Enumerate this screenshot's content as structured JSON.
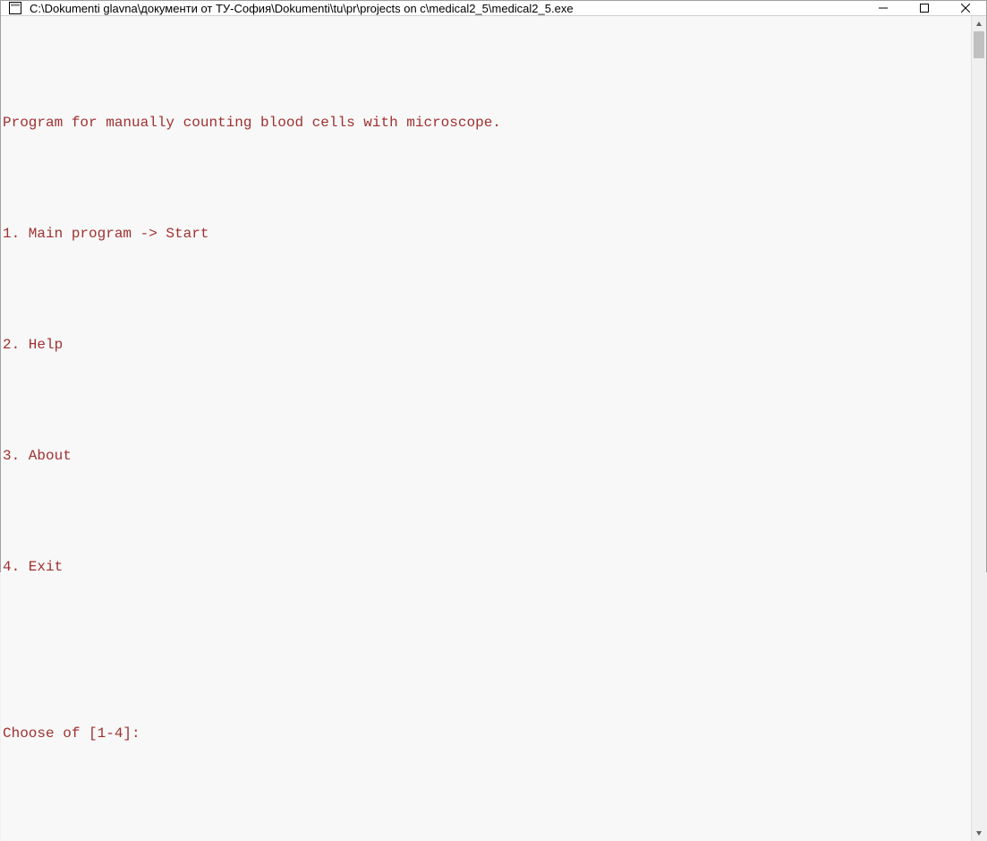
{
  "titlebar": {
    "title": "C:\\Dokumenti glavna\\документи от ТУ-София\\Dokumenti\\tu\\pr\\projects on c\\medical2_5\\medical2_5.exe"
  },
  "console": {
    "lines": [
      "",
      "Program for manually counting blood cells with microscope.",
      "",
      "1. Main program -> Start",
      "",
      "2. Help",
      "",
      "3. About",
      "",
      "4. Exit",
      "",
      "",
      "Choose of [1-4]:",
      ""
    ]
  },
  "colors": {
    "text": "#a03030",
    "background": "#f8f8f8"
  }
}
